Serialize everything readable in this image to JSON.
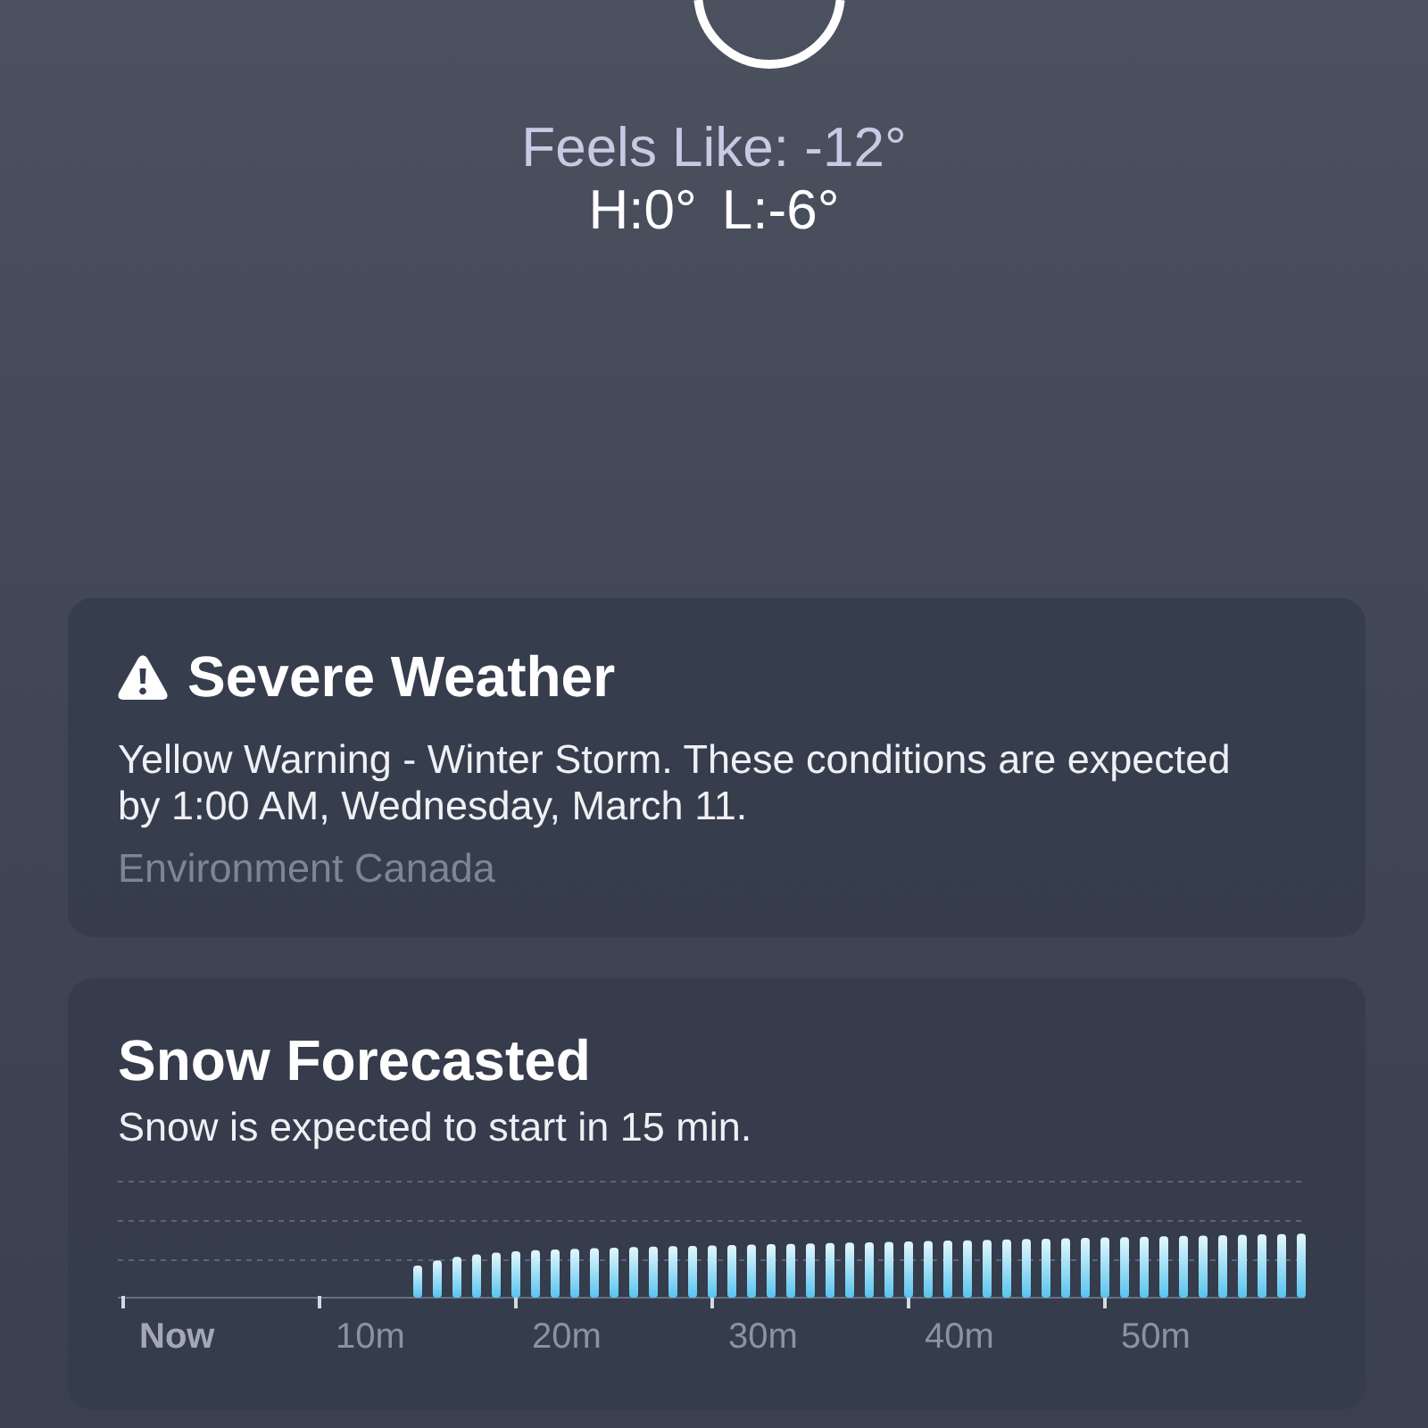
{
  "current": {
    "feels_like": "Feels Like: -12°",
    "high": "H:0°",
    "low": "L:-6°"
  },
  "severe_weather": {
    "title": "Severe Weather",
    "message": "Yellow Warning - Winter Storm. These conditions are expected by 1:00 AM, Wednesday, March 11.",
    "source": "Environment Canada"
  },
  "precipitation": {
    "title": "Snow Forecasted",
    "summary": "Snow is expected to start in 15 min.",
    "time_labels": [
      {
        "label": "Now",
        "current": true
      },
      {
        "label": "10m",
        "current": false
      },
      {
        "label": "20m",
        "current": false
      },
      {
        "label": "30m",
        "current": false
      },
      {
        "label": "40m",
        "current": false
      },
      {
        "label": "50m",
        "current": false
      }
    ]
  }
}
